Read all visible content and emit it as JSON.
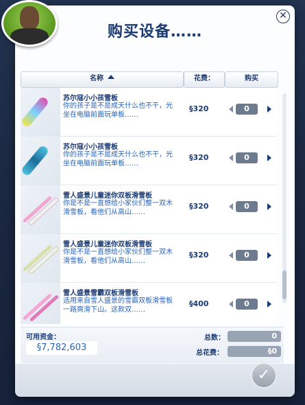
{
  "dialog": {
    "title": "购买设备……",
    "close_glyph": "✕"
  },
  "table": {
    "header_name": "名称",
    "header_cost": "花费：",
    "header_buy": "购买"
  },
  "items": [
    {
      "name": "苏尔寇小小孩雪板",
      "desc": "你的孩子是不是成天什么也不干，光坐在电脑前面玩单板……",
      "price": "§320",
      "qty": "0",
      "color_a": "#e44fb0",
      "color_b": "#6fd0ff"
    },
    {
      "name": "苏尔寇小小孩雪板",
      "desc": "你的孩子是不是成天什么也不干，光坐在电脑前面玩单板……",
      "price": "§320",
      "qty": "0",
      "color_a": "#3fb3d6",
      "color_b": "#1b6e9a"
    },
    {
      "name": "雪人盛景儿童迷你双板滑雪板",
      "desc": "你是不是一直想给小家伙们整一双木滑雪板，看他们从高山……",
      "price": "§320",
      "qty": "0",
      "color_a": "#f2a7d2",
      "color_b": "#f7f7f7"
    },
    {
      "name": "雪人盛景儿童迷你双板滑雪板",
      "desc": "你是不是一直想给小家伙们整一双木滑雪板，看他们从高山……",
      "price": "§320",
      "qty": "0",
      "color_a": "#d8e0a8",
      "color_b": "#f7f7f7"
    },
    {
      "name": "雪人盛景雪霸双板滑雪板",
      "desc": "选用来自雪人盛景的雪霸双板滑雪板一路爽滑下山。这款双……",
      "price": "§400",
      "qty": "0",
      "color_a": "#f4a7d4",
      "color_b": "#e07bb8"
    }
  ],
  "footer": {
    "funds_label": "可用资金：",
    "funds_value": "§7,782,603",
    "total_count_label": "总数：",
    "total_count_value": "0",
    "total_cost_label": "总花费：",
    "total_cost_value": "§0"
  },
  "icons": {
    "confirm": "checkmark-icon",
    "close": "close-icon",
    "sort": "sort-ascending-icon"
  },
  "colors": {
    "accent": "#1c3a72",
    "link_text": "#2a63b8",
    "qty_bg": "#6d7b8e"
  }
}
